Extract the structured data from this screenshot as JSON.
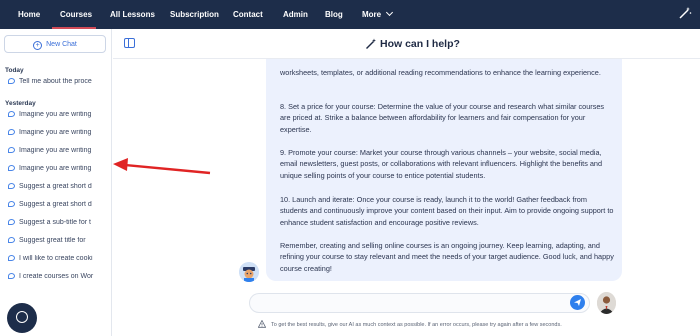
{
  "nav": {
    "items": [
      "Home",
      "Courses",
      "All Lessons",
      "Subscription",
      "Contact",
      "Admin",
      "Blog",
      "More"
    ],
    "active": "Courses",
    "accent_color": "#d24b57",
    "bar_color": "#1d2d4a"
  },
  "sidebar": {
    "new_chat_label": "New Chat",
    "today_label": "Today",
    "yesterday_label": "Yesterday",
    "today_items": [
      "Tell me about the proce"
    ],
    "yesterday_items": [
      "Imagine you are writing",
      "Imagine you are writing",
      "Imagine you are writing",
      "Imagine you are writing",
      "Suggest a great short d",
      "Suggest a great short d",
      "Suggest a sub-title for t",
      "Suggest great title for",
      "I will like to create cooki",
      "I create courses on Wor"
    ]
  },
  "main": {
    "title": "How can I help?",
    "message_paragraphs": [
      "worksheets, templates, or additional reading recommendations to enhance the learning experience.",
      "8. Set a price for your course: Determine the value of your course and research what similar courses are priced at. Strike a balance between affordability for learners and fair compensation for your expertise.",
      "9. Promote your course: Market your course through various channels – your website, social media, email newsletters, guest posts, or collaborations with relevant influencers. Highlight the benefits and unique selling points of your course to entice potential students.",
      "10. Launch and iterate: Once your course is ready, launch it to the world! Gather feedback from students and continuously improve your content based on their input. Aim to provide ongoing support to enhance student satisfaction and encourage positive reviews.",
      "Remember, creating and selling online courses is an ongoing journey. Keep learning, adapting, and refining your course to stay relevant and meet the needs of your target audience. Good luck, and happy course creating!"
    ],
    "input_value": "",
    "footnote": "To get the best results, give our AI as much context as possible. If an error occurs, please try again after a few seconds."
  },
  "icons": [
    "magic-wand-icon",
    "chevron-down-icon",
    "plus-circle-icon",
    "chat-bubble-icon",
    "sidebar-toggle-icon",
    "send-icon",
    "warning-icon",
    "help-chat-icon"
  ]
}
